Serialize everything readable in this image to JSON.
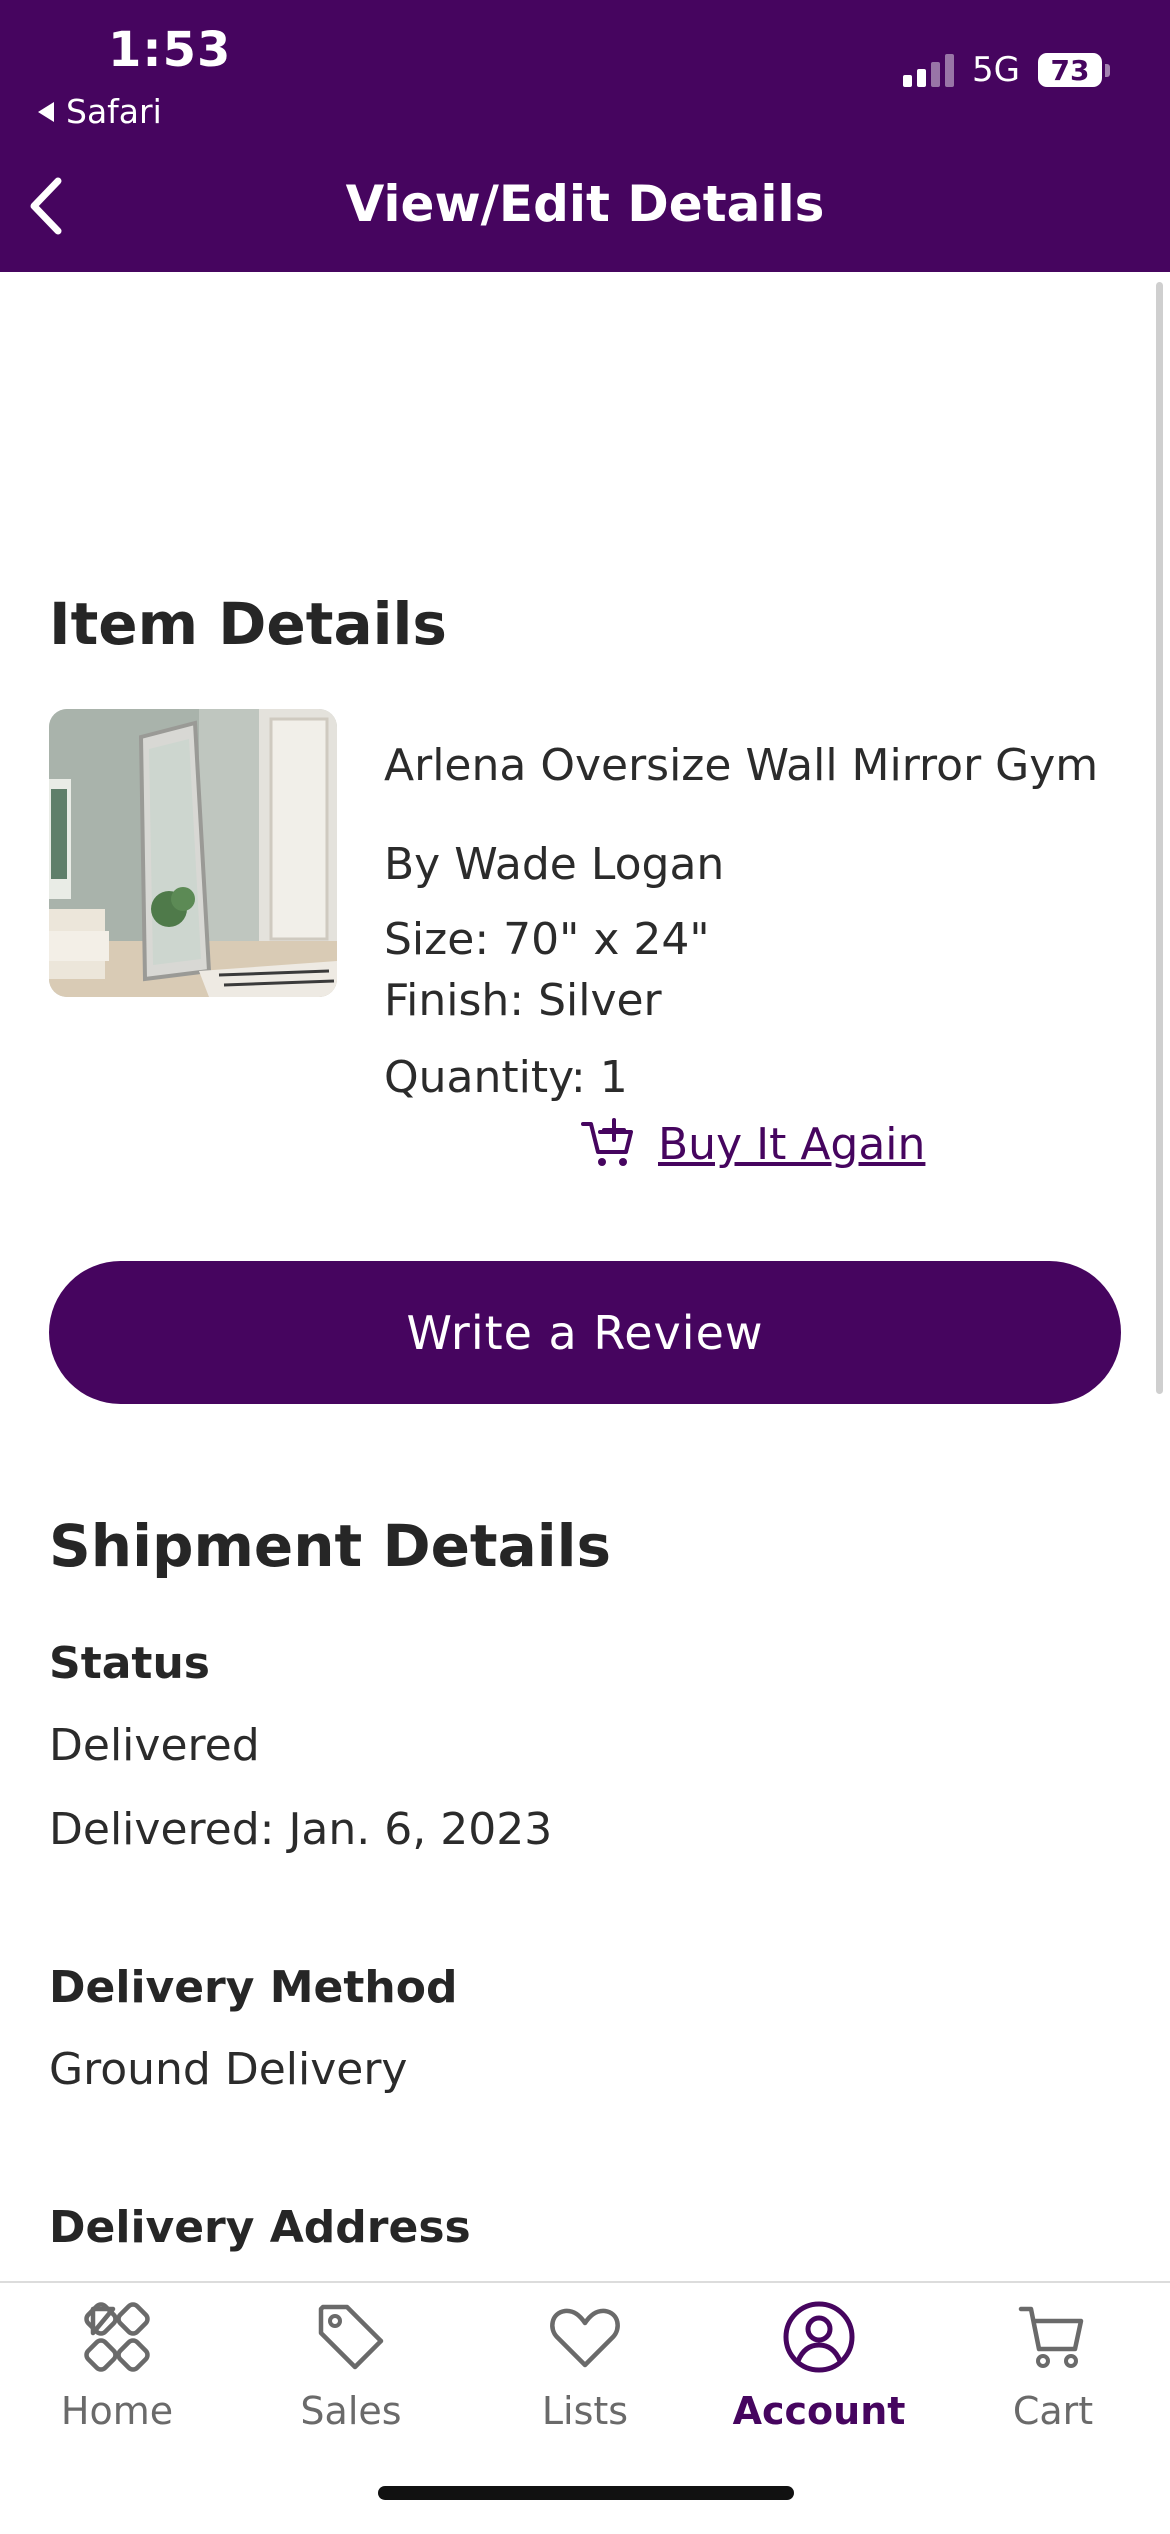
{
  "status_bar": {
    "time": "1:53",
    "back_app": "Safari",
    "network": "5G",
    "battery": "73"
  },
  "header": {
    "title": "View/Edit Details"
  },
  "item_details": {
    "heading": "Item Details",
    "name": "Arlena Oversize Wall Mirror Gym",
    "by": "By Wade Logan",
    "size": "Size: 70\" x 24\"",
    "finish": "Finish: Silver",
    "quantity": "Quantity: 1",
    "buy_again": "Buy It Again",
    "review_button": "Write a Review"
  },
  "shipment": {
    "heading": "Shipment Details",
    "status_label": "Status",
    "status_value": "Delivered",
    "delivered_date": "Delivered: Jan. 6, 2023",
    "method_label": "Delivery Method",
    "method_value": "Ground Delivery",
    "address_label": "Delivery Address"
  },
  "tabs": [
    {
      "label": "Home",
      "icon": "home-icon"
    },
    {
      "label": "Sales",
      "icon": "tag-icon"
    },
    {
      "label": "Lists",
      "icon": "heart-icon"
    },
    {
      "label": "Account",
      "icon": "account-icon",
      "active": true
    },
    {
      "label": "Cart",
      "icon": "cart-icon"
    }
  ],
  "colors": {
    "brand": "#46055f",
    "text": "#2b2b2b",
    "inactive_tab": "#6a6a6a"
  }
}
